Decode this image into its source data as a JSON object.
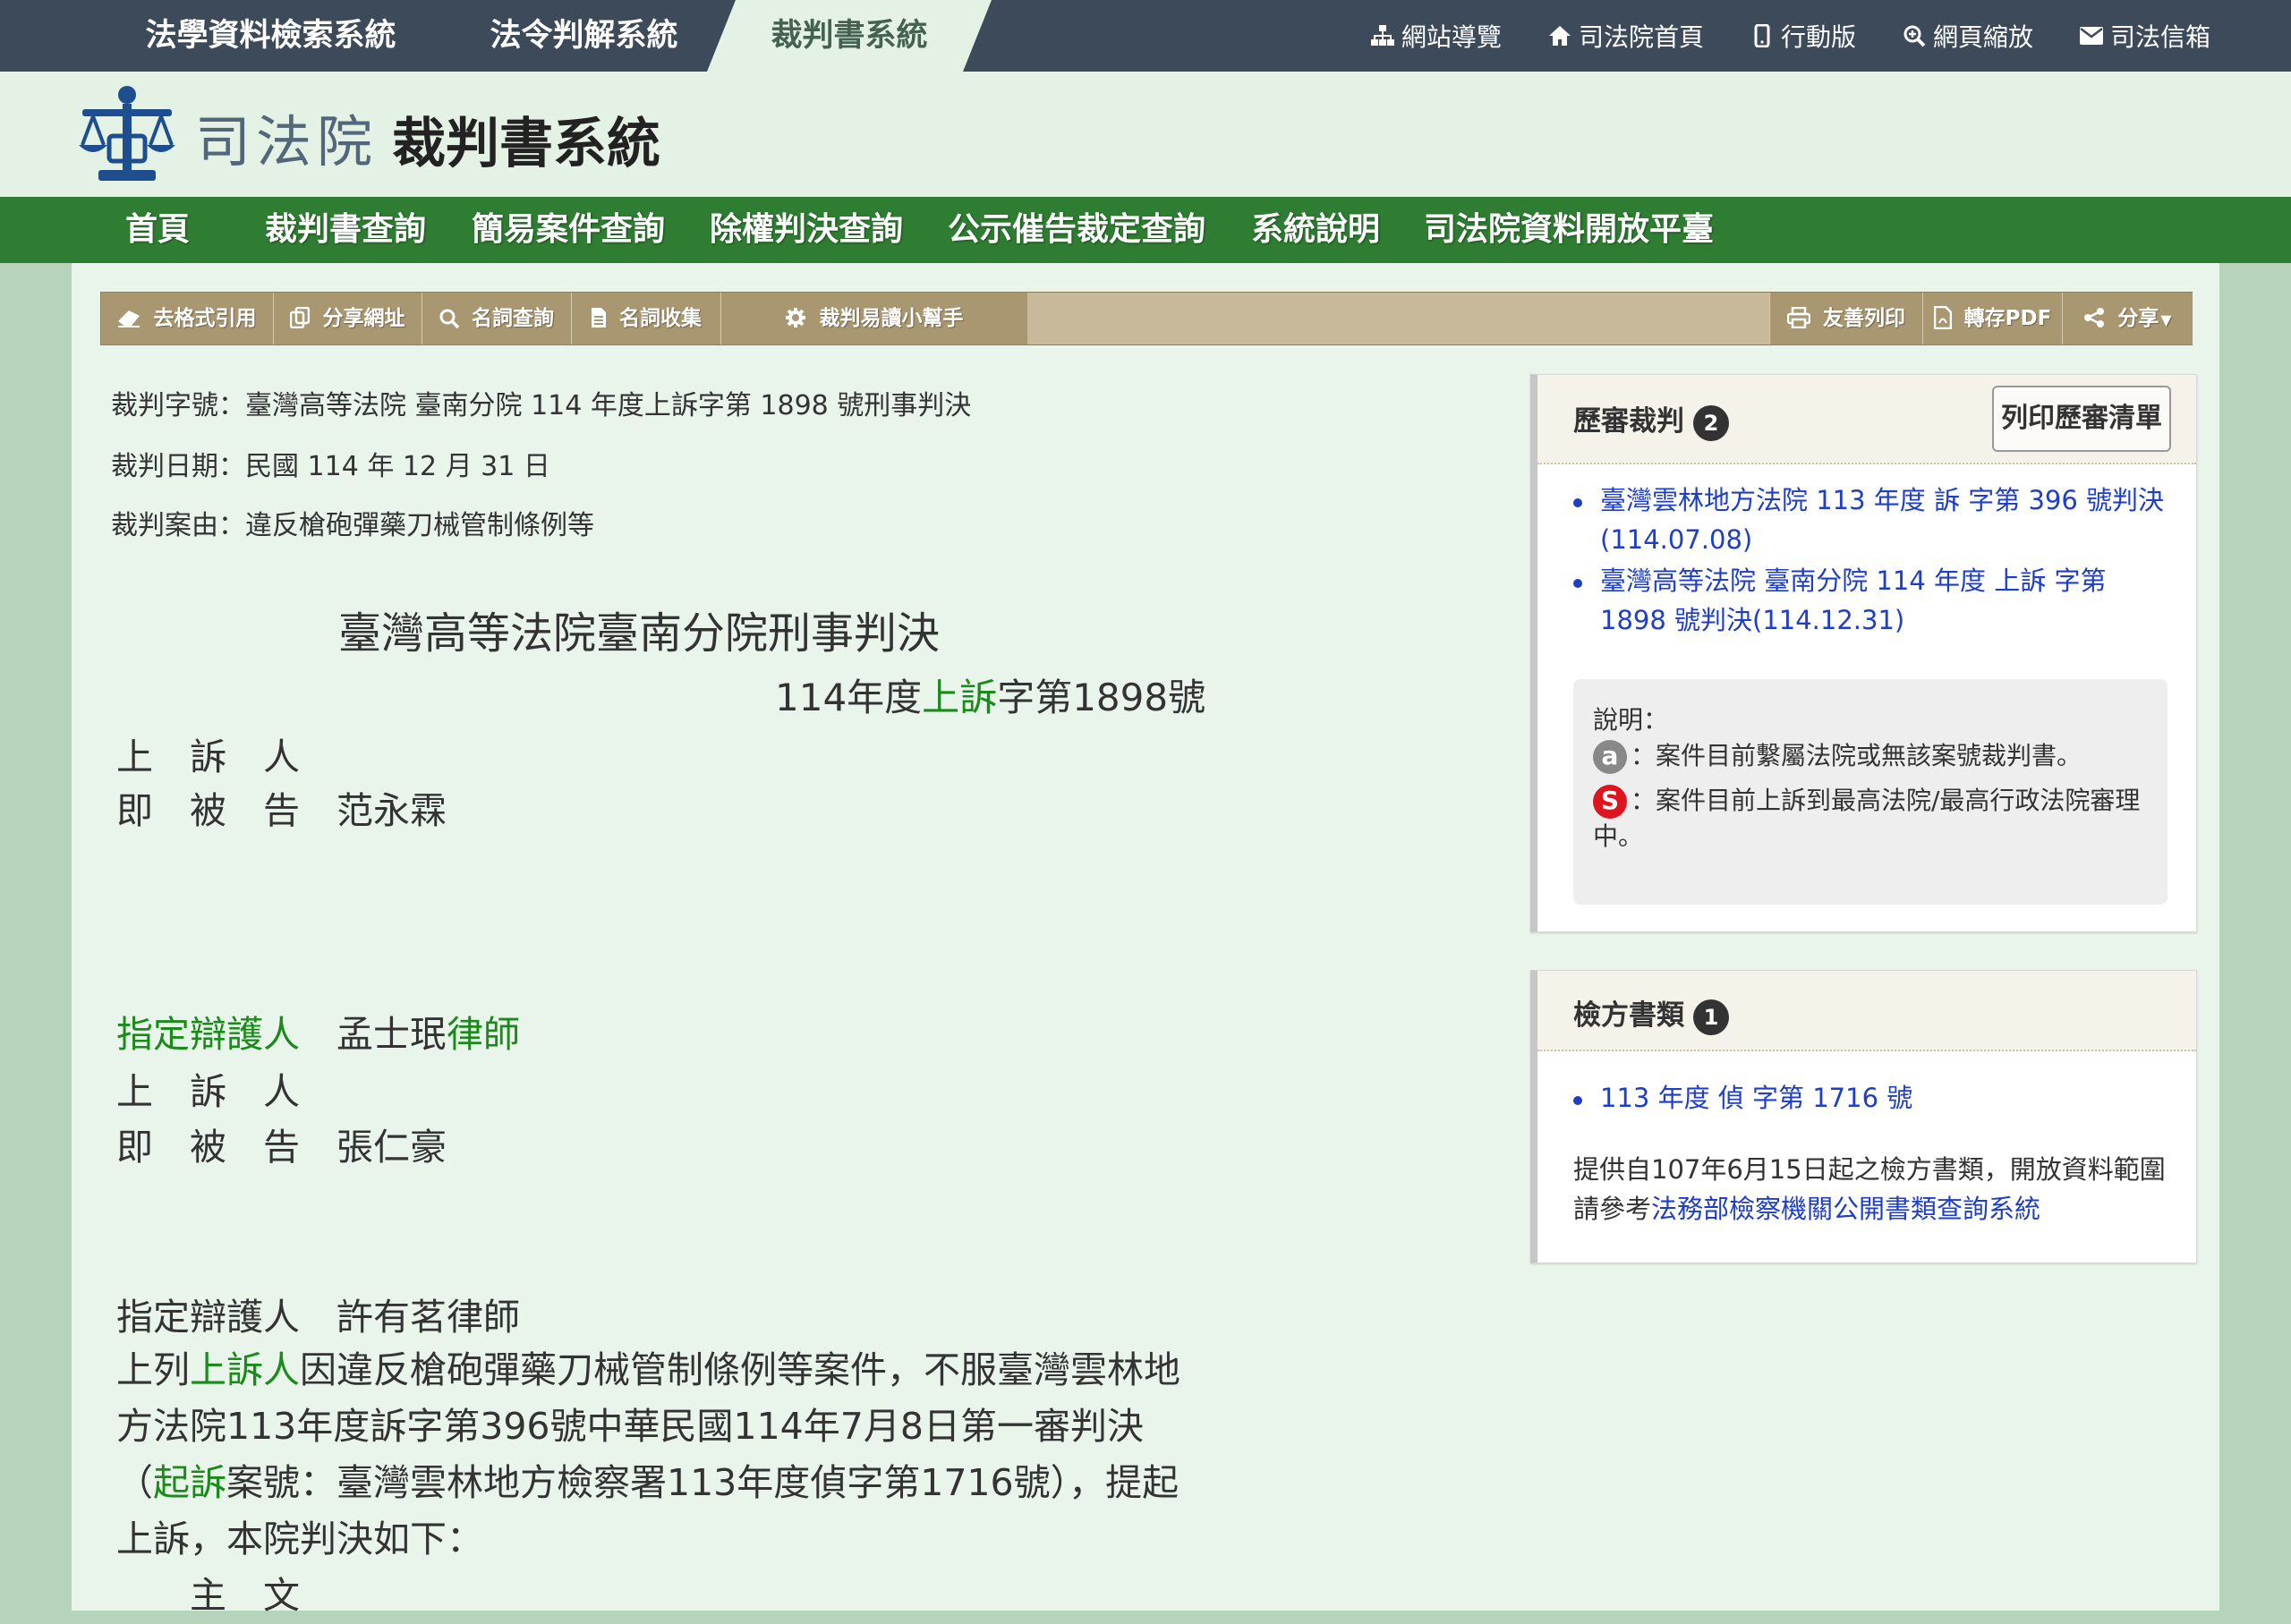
{
  "top_tabs": [
    "法學資料檢索系統",
    "法令判解系統",
    "裁判書系統"
  ],
  "top_links": [
    {
      "icon": "sitemap-icon",
      "label": "網站導覽"
    },
    {
      "icon": "home-icon",
      "label": "司法院首頁"
    },
    {
      "icon": "mobile-icon",
      "label": "行動版"
    },
    {
      "icon": "zoom-icon",
      "label": "網頁縮放"
    },
    {
      "icon": "envelope-icon",
      "label": "司法信箱"
    }
  ],
  "header": {
    "org": "司法院",
    "system": "裁判書系統"
  },
  "main_nav": [
    "首頁",
    "裁判書查詢",
    "簡易案件查詢",
    "除權判決查詢",
    "公示催告裁定查詢",
    "系統說明",
    "司法院資料開放平臺"
  ],
  "toolbar": {
    "left": [
      {
        "icon": "eraser-icon",
        "label": "去格式引用"
      },
      {
        "icon": "copy-icon",
        "label": "分享網址"
      },
      {
        "icon": "search-icon",
        "label": "名詞查詢"
      },
      {
        "icon": "document-icon",
        "label": "名詞收集"
      },
      {
        "icon": "gear-icon",
        "label": "裁判易讀小幫手"
      }
    ],
    "right": [
      {
        "icon": "print-icon",
        "label": "友善列印"
      },
      {
        "icon": "pdf-icon",
        "label": "轉存PDF"
      },
      {
        "icon": "share-icon",
        "label": "分享"
      }
    ]
  },
  "meta": {
    "case_no": "裁判字號：臺灣高等法院 臺南分院 114 年度上訴字第 1898 號刑事判決",
    "date": "裁判日期：民國 114 年 12 月 31 日",
    "cause": "裁判案由：違反槍砲彈藥刀械管制條例等"
  },
  "judgment": {
    "title": "臺灣高等法院臺南分院刑事判決",
    "case_pre": "114年度",
    "case_link": "上訴",
    "case_post": "字第1898號",
    "role1a": "上　訴　人",
    "role1b": "即　被　告",
    "name1": "范永霖",
    "def1_role": "指定辯護人",
    "def1_name": "孟士珉",
    "def1_suffix": "律師",
    "role2a": "上　訴　人",
    "role2b": "即　被　告",
    "name2": "張仁豪",
    "def2_line": "指定辯護人　許有茗律師",
    "para_p1": "上列",
    "para_link1": "上訴人",
    "para_p2": "因違反槍砲彈藥刀械管制條例等案件，不服臺灣雲林地方法院113年度訴字第396號中華民國114年7月8日第一審判決（",
    "para_link2": "起訴",
    "para_p3": "案號：臺灣雲林地方檢察署113年度偵字第1716號），提起上訴，本院判決如下：",
    "main_heading": "主　文"
  },
  "history_box": {
    "title": "歷審裁判",
    "count": "2",
    "print_label": "列印歷審清單",
    "items": [
      "臺灣雲林地方法院 113 年度 訴 字第 396 號判決(114.07.08)",
      "臺灣高等法院 臺南分院 114 年度 上訴 字第 1898 號判決(114.12.31)"
    ],
    "legend_label": "說明：",
    "legend_a_icon": "a",
    "legend_a_text": "：案件目前繫屬法院或無該案號裁判書。",
    "legend_s_icon": "S",
    "legend_s_text": "：案件目前上訴到最高法院/最高行政法院審理中。"
  },
  "prosecutor_box": {
    "title": "檢方書類",
    "count": "1",
    "items": [
      "113 年度 偵 字第 1716 號"
    ],
    "note_pre": "提供自107年6月15日起之檢方書類，開放資料範圍請參考",
    "note_link": "法務部檢察機關公開書類查詢系統"
  }
}
